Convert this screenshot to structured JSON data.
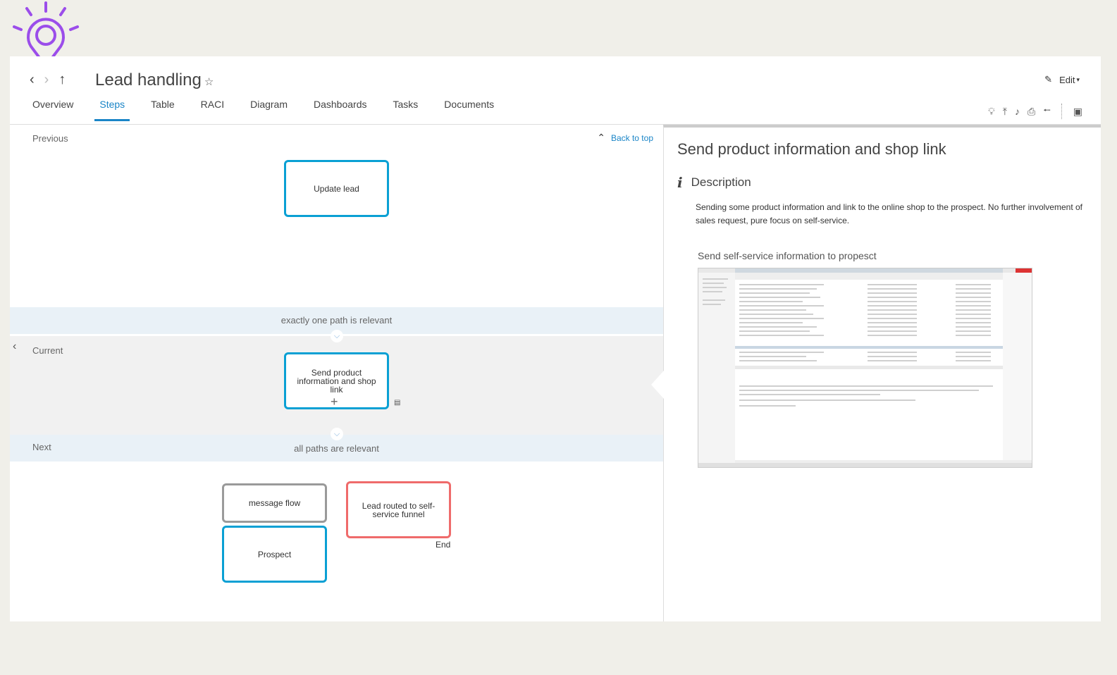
{
  "header": {
    "title": "Lead handling",
    "star": "☆",
    "edit_label": "Edit"
  },
  "tabs": [
    "Overview",
    "Steps",
    "Table",
    "RACI",
    "Diagram",
    "Dashboards",
    "Tasks",
    "Documents"
  ],
  "active_tab": "Steps",
  "steps": {
    "previous_label": "Previous",
    "back_to_top": "Back to top",
    "previous_step": "Update lead",
    "gateway_1": "exactly one path is relevant",
    "current_label": "Current",
    "current_step": "Send product information and shop link",
    "next_label": "Next",
    "gateway_2": "all paths are relevant",
    "next_message": "message flow",
    "next_participant": "Prospect",
    "next_end": "Lead routed to self-service funnel",
    "end_label": "End"
  },
  "detail": {
    "title": "Send product information and shop link",
    "description_heading": "Description",
    "description": "Sending some product information and link to the online shop to the prospect. No further involvement of sales request, pure focus on self-service.",
    "attachment_title": "Send self-service information to propesct"
  },
  "colors": {
    "accent": "#1a85c7",
    "task_border": "#0aa0d4",
    "end_border": "#ef6b6b",
    "logo": "#9b4dea"
  }
}
